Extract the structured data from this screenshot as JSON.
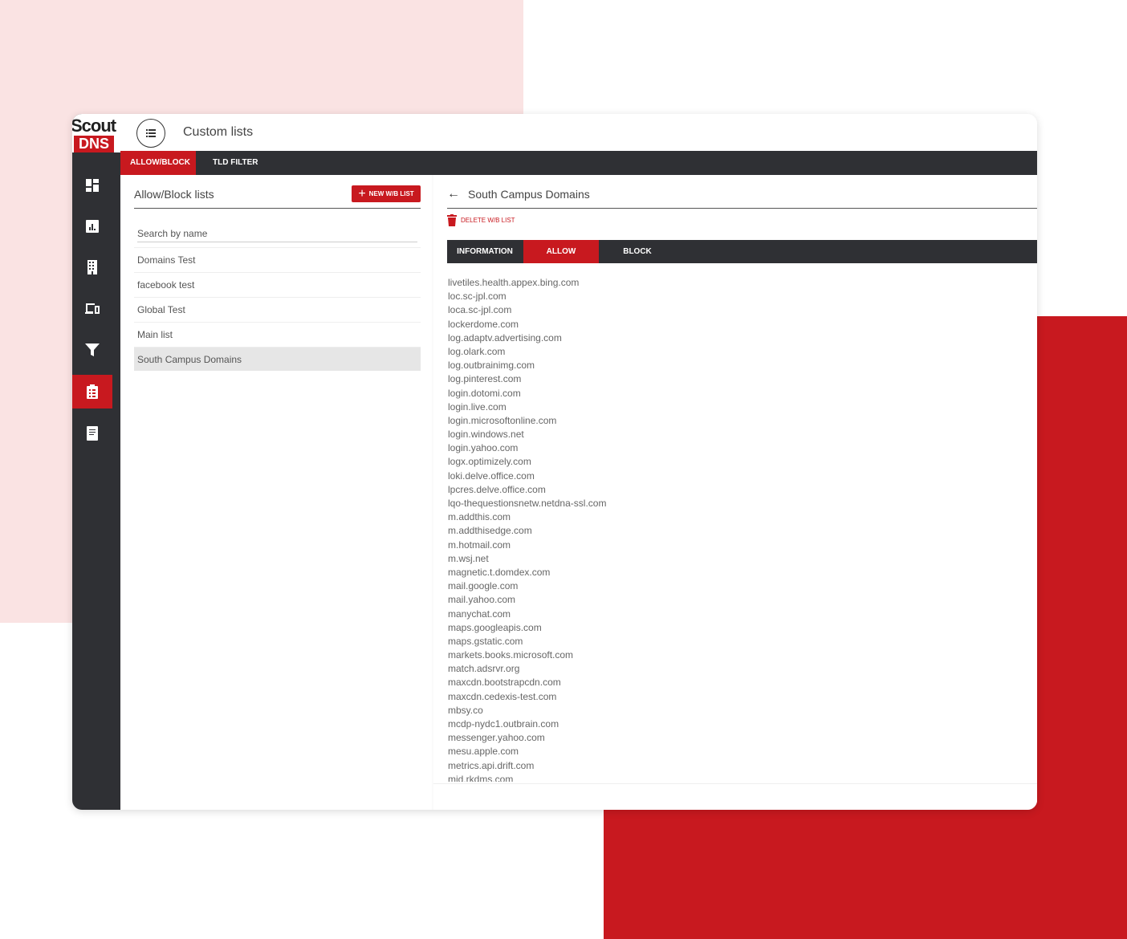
{
  "app": {
    "logo_top": "Scout",
    "logo_bottom": "DNS"
  },
  "colors": {
    "accent": "#c8191f",
    "dark": "#2f3034",
    "pink_bg": "#fae3e3"
  },
  "header": {
    "title": "Custom lists",
    "menu_icon": "list-icon"
  },
  "tabs": [
    {
      "label": "ALLOW/BLOCK",
      "active": true
    },
    {
      "label": "TLD FILTER",
      "active": false
    }
  ],
  "sidebar": {
    "items": [
      {
        "icon": "dashboard-icon"
      },
      {
        "icon": "report-icon"
      },
      {
        "icon": "building-icon"
      },
      {
        "icon": "devices-icon"
      },
      {
        "icon": "filter-icon"
      },
      {
        "icon": "clipboard-list-icon",
        "active": true
      },
      {
        "icon": "book-icon"
      }
    ]
  },
  "left_panel": {
    "title": "Allow/Block lists",
    "new_button": "NEW W/B LIST",
    "search_placeholder": "Search by name",
    "lists": [
      "Domains Test",
      "facebook test",
      "Global Test",
      "Main list",
      "South Campus Domains"
    ],
    "selected": "South Campus Domains"
  },
  "right_panel": {
    "title": "South Campus Domains",
    "delete_button": "DELETE W/B LIST",
    "subtabs": [
      {
        "label": "INFORMATION",
        "active": false
      },
      {
        "label": "ALLOW",
        "active": true
      },
      {
        "label": "BLOCK",
        "active": false
      }
    ],
    "domains": [
      "livetiles.health.appex.bing.com",
      "loc.sc-jpl.com",
      "loca.sc-jpl.com",
      "lockerdome.com",
      "log.adaptv.advertising.com",
      "log.olark.com",
      "log.outbrainimg.com",
      "log.pinterest.com",
      "login.dotomi.com",
      "login.live.com",
      "login.microsoftonline.com",
      "login.windows.net",
      "login.yahoo.com",
      "logx.optimizely.com",
      "loki.delve.office.com",
      "lpcres.delve.office.com",
      "lqo-thequestionsnetw.netdna-ssl.com",
      "m.addthis.com",
      "m.addthisedge.com",
      "m.hotmail.com",
      "m.wsj.net",
      "magnetic.t.domdex.com",
      "mail.google.com",
      "mail.yahoo.com",
      "manychat.com",
      "maps.googleapis.com",
      "maps.gstatic.com",
      "markets.books.microsoft.com",
      "match.adsrvr.org",
      "maxcdn.bootstrapcdn.com",
      "maxcdn.cedexis-test.com",
      "mbsy.co",
      "mcdp-nydc1.outbrain.com",
      "messenger.yahoo.com",
      "mesu.apple.com",
      "metrics.api.drift.com",
      "mid.rkdms.com"
    ]
  }
}
